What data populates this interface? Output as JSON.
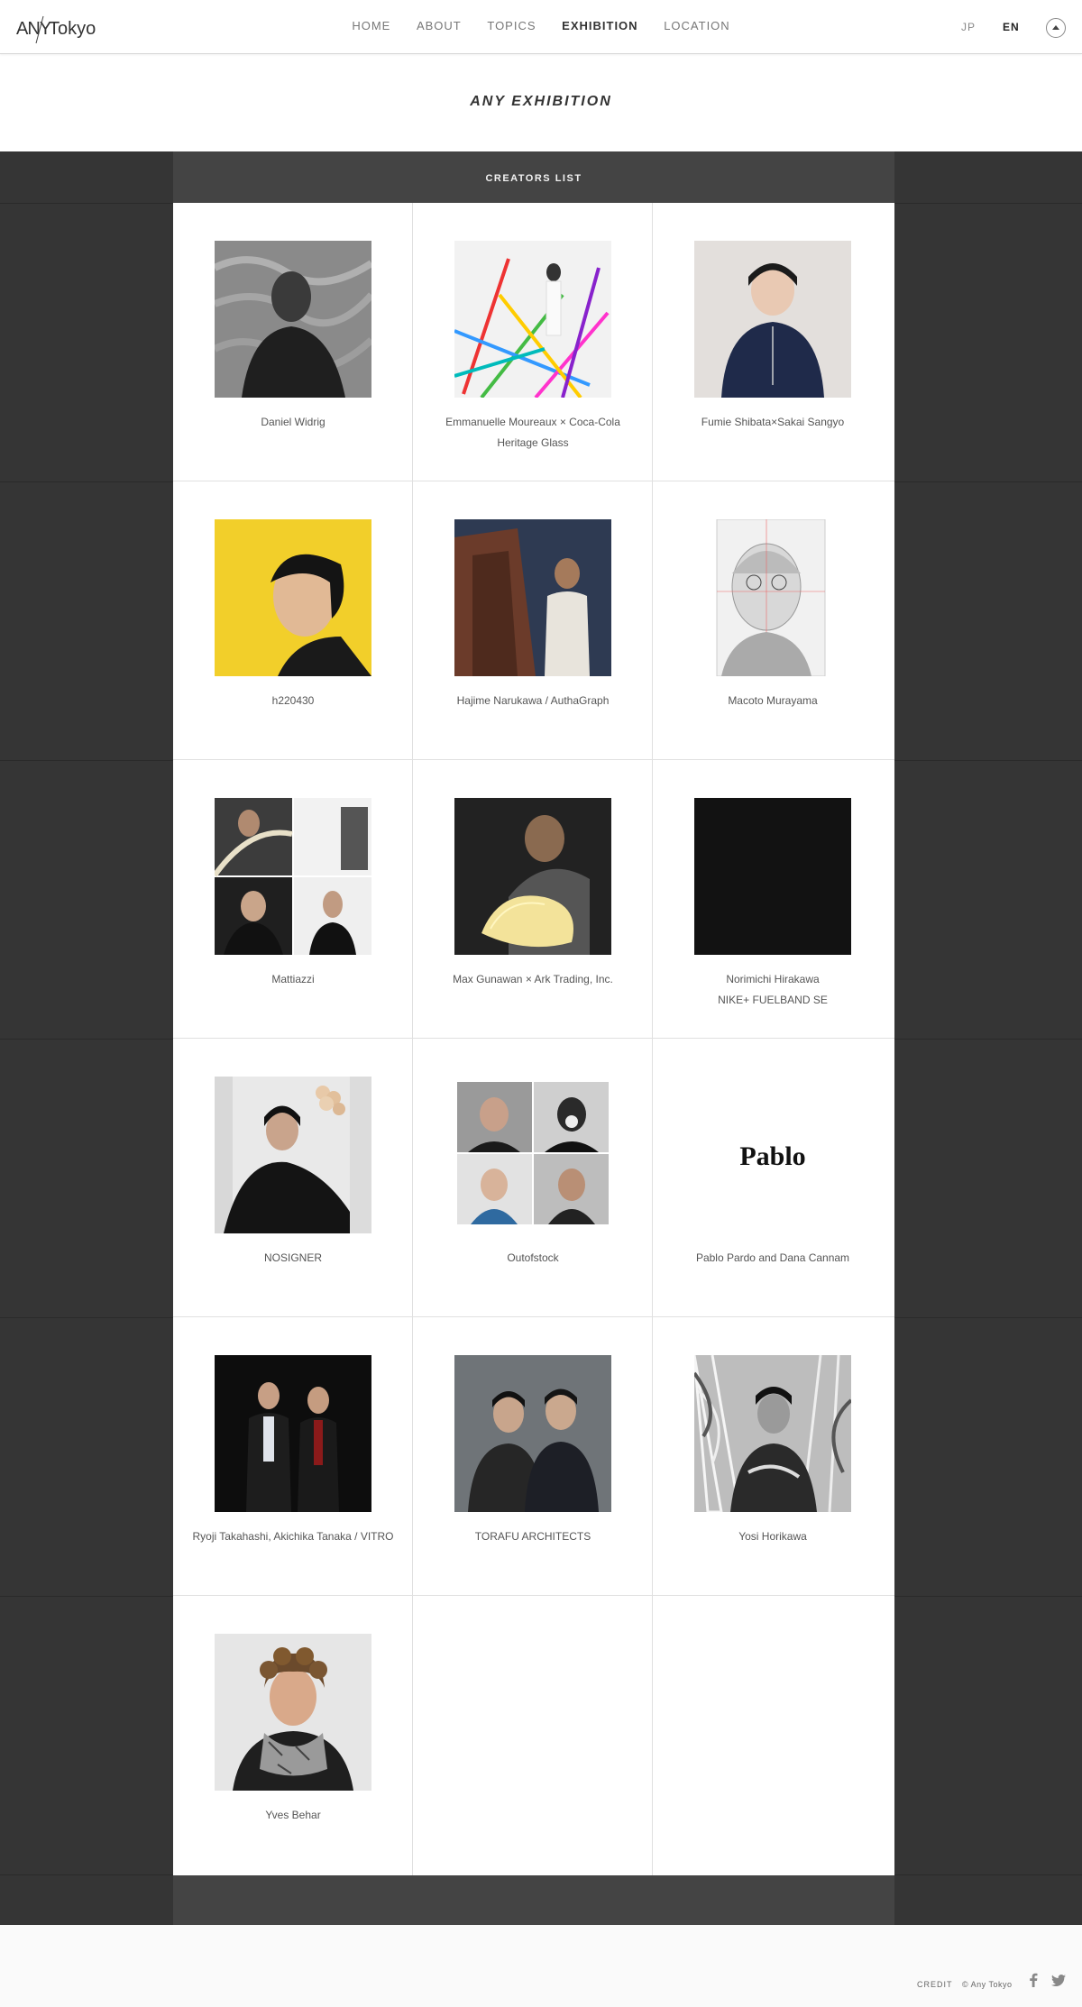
{
  "header": {
    "logo_text": "ANYTokyo",
    "nav": [
      "HOME",
      "ABOUT",
      "TOPICS",
      "EXHIBITION",
      "LOCATION"
    ],
    "active_nav": "EXHIBITION",
    "lang_jp": "JP",
    "lang_en": "EN",
    "top_icon": "arrow-up-icon"
  },
  "page_title": "ANY EXHIBITION",
  "creators_list_label": "CREATORS LIST",
  "creators": [
    {
      "name": "Daniel Widrig",
      "name2": ""
    },
    {
      "name": "Emmanuelle Moureaux × Coca-Cola",
      "name2": "Heritage Glass"
    },
    {
      "name": "Fumie Shibata×Sakai Sangyo",
      "name2": ""
    },
    {
      "name": "h220430",
      "name2": ""
    },
    {
      "name": "Hajime Narukawa / AuthaGraph",
      "name2": ""
    },
    {
      "name": "Macoto Murayama",
      "name2": ""
    },
    {
      "name": "Mattiazzi",
      "name2": ""
    },
    {
      "name": "Max Gunawan × Ark Trading, Inc.",
      "name2": ""
    },
    {
      "name": "Norimichi Hirakawa",
      "name2": "NIKE+ FUELBAND SE"
    },
    {
      "name": "NOSIGNER",
      "name2": ""
    },
    {
      "name": "Outofstock",
      "name2": ""
    },
    {
      "name": "Pablo Pardo and Dana Cannam",
      "name2": "",
      "logo_text": "Pablo"
    },
    {
      "name": "Ryoji Takahashi, Akichika Tanaka / VITRO",
      "name2": ""
    },
    {
      "name": "TORAFU ARCHITECTS",
      "name2": ""
    },
    {
      "name": "Yosi Horikawa",
      "name2": ""
    },
    {
      "name": "Yves Behar",
      "name2": ""
    }
  ],
  "footer": {
    "credit": "CREDIT",
    "copyright": "© Any Tokyo",
    "icons": [
      "facebook-icon",
      "twitter-icon"
    ]
  }
}
